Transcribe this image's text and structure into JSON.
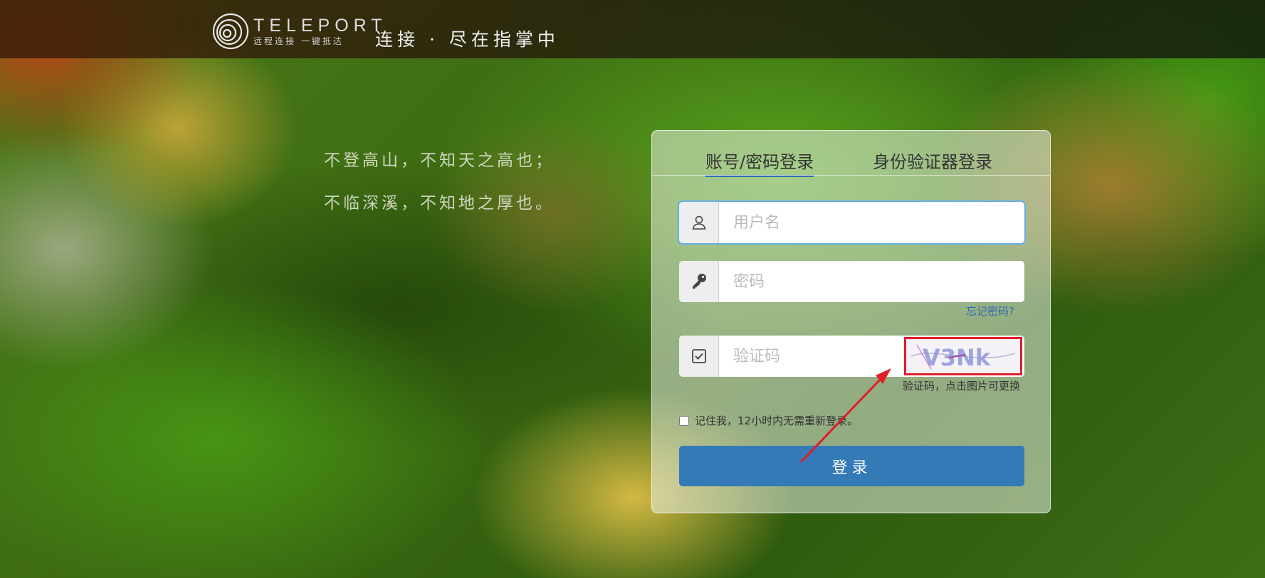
{
  "header": {
    "logo_name": "TELEPORT",
    "logo_sub": "远程连接 一键抵达",
    "slogan": "连接 · 尽在指掌中"
  },
  "poem": {
    "line1": "不登高山，不知天之高也；",
    "line2": "不临深溪，不知地之厚也。"
  },
  "login": {
    "tabs": [
      {
        "label": "账号/密码登录",
        "active": true
      },
      {
        "label": "身份验证器登录",
        "active": false
      }
    ],
    "username": {
      "placeholder": "用户名",
      "value": "",
      "icon": "user-icon"
    },
    "password": {
      "placeholder": "密码",
      "value": "",
      "icon": "key-icon"
    },
    "forgot_label": "忘记密码?",
    "captcha": {
      "placeholder": "验证码",
      "value": "",
      "icon": "check-square-icon",
      "image_text": "V3Nk"
    },
    "captcha_hint": "验证码，点击图片可更换",
    "remember_label": "记住我，12小时内无需重新登录。",
    "remember_checked": false,
    "submit_label": "登录"
  },
  "colors": {
    "primary": "#337ab7",
    "link": "#2f6db0",
    "highlight": "#e01e2a"
  }
}
